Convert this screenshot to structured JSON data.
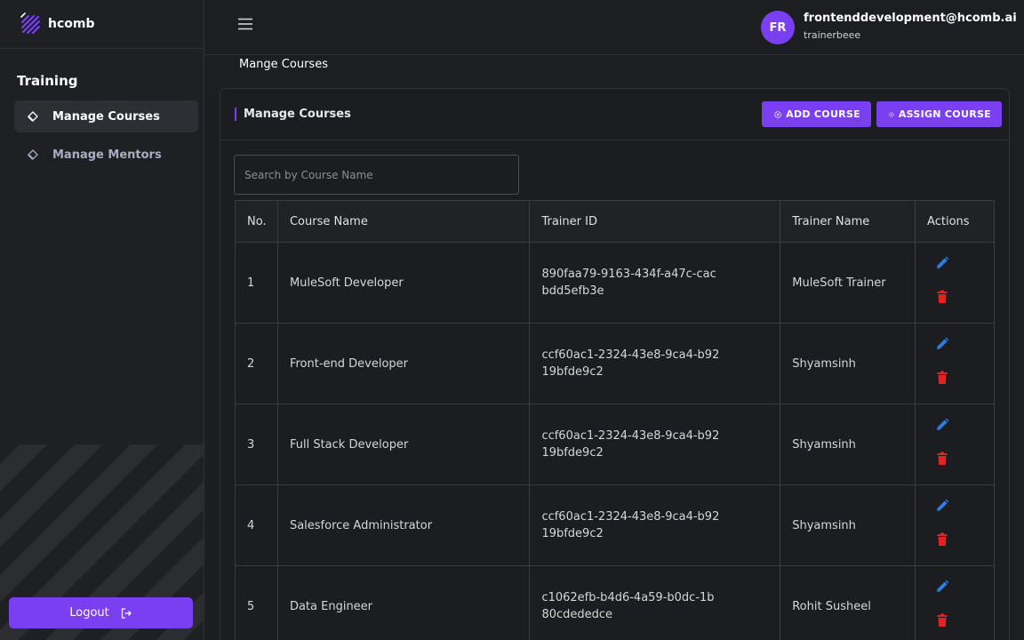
{
  "app": {
    "name": "hcomb"
  },
  "sidebar": {
    "section_title": "Training",
    "items": [
      {
        "label": "Manage Courses",
        "active": true
      },
      {
        "label": "Manage Mentors",
        "active": false
      }
    ],
    "logout_label": "Logout"
  },
  "topbar": {
    "avatar_initials": "FR",
    "user_email": "frontenddevelopment@hcomb.ai",
    "user_role": "trainerbeee"
  },
  "page": {
    "breadcrumb": "Mange Courses"
  },
  "card": {
    "title": "Manage Courses",
    "add_button": "ADD COURSE",
    "assign_button": "ASSIGN COURSE",
    "search_placeholder": "Search by Course Name"
  },
  "table": {
    "headers": [
      "No.",
      "Course Name",
      "Trainer ID",
      "Trainer Name",
      "Actions"
    ],
    "rows": [
      {
        "no": "1",
        "course": "MuleSoft Developer",
        "trainer_id": "890faa79-9163-434f-a47c-cacbdd5efb3e",
        "trainer_name": "MuleSoft Trainer"
      },
      {
        "no": "2",
        "course": "Front-end Developer",
        "trainer_id": "ccf60ac1-2324-43e8-9ca4-b9219bfde9c2",
        "trainer_name": "Shyamsinh"
      },
      {
        "no": "3",
        "course": "Full Stack Developer",
        "trainer_id": "ccf60ac1-2324-43e8-9ca4-b9219bfde9c2",
        "trainer_name": "Shyamsinh"
      },
      {
        "no": "4",
        "course": "Salesforce Administrator",
        "trainer_id": "ccf60ac1-2324-43e8-9ca4-b9219bfde9c2",
        "trainer_name": "Shyamsinh"
      },
      {
        "no": "5",
        "course": "Data Engineer",
        "trainer_id": "c1062efb-b4d6-4a59-b0dc-1b80cdededce",
        "trainer_name": "Rohit Susheel"
      }
    ]
  },
  "icons": {
    "logo": "hcomb-logo-icon",
    "nav": "diamond-icon",
    "menu": "hamburger-icon",
    "logout": "logout-icon",
    "add": "plus-circle-icon",
    "edit": "pencil-icon",
    "delete": "trash-icon"
  },
  "colors": {
    "accent": "#7b3ff2",
    "background": "#1c1e21",
    "edit": "#2f7de1",
    "delete": "#e02424"
  }
}
